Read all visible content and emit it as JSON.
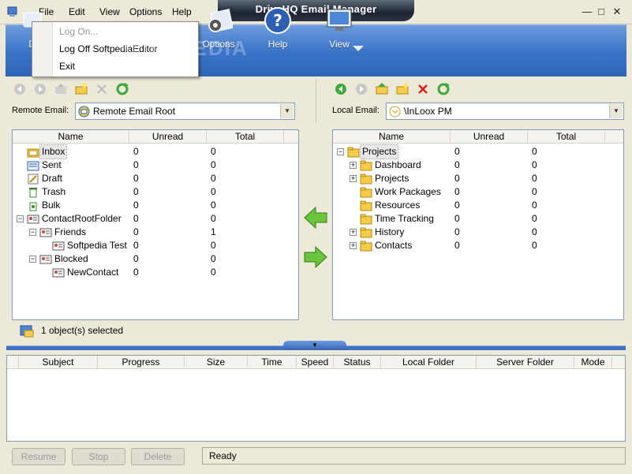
{
  "window": {
    "title": "DriveHQ Email Manager",
    "menu": [
      "File",
      "Edit",
      "View",
      "Options",
      "Help"
    ],
    "controls": {
      "minimize": "—",
      "restore": "□",
      "close": "✕"
    }
  },
  "ribbon": {
    "buttons": [
      {
        "label": "Di",
        "icon": "disconnect-icon"
      },
      {
        "label": "Options",
        "icon": "gear-icon"
      },
      {
        "label": "Help",
        "icon": "help-icon"
      },
      {
        "label": "View",
        "icon": "monitor-icon"
      }
    ]
  },
  "file_menu": {
    "items": [
      {
        "label": "Log On...",
        "disabled": true
      },
      {
        "label": "Log Off SoftpediaEditor",
        "disabled": false
      },
      {
        "label": "Exit",
        "disabled": false
      }
    ]
  },
  "remote": {
    "label": "Remote Email:",
    "selected": "Remote Email Root",
    "columns": [
      "Name",
      "Unread",
      "Total"
    ],
    "rows": [
      {
        "name": "Inbox",
        "unread": "0",
        "total": "0",
        "icon": "inbox-folder-icon",
        "level": 0,
        "expander": ""
      },
      {
        "name": "Sent",
        "unread": "0",
        "total": "0",
        "icon": "sent-folder-icon",
        "level": 0,
        "expander": ""
      },
      {
        "name": "Draft",
        "unread": "0",
        "total": "0",
        "icon": "draft-folder-icon",
        "level": 0,
        "expander": ""
      },
      {
        "name": "Trash",
        "unread": "0",
        "total": "0",
        "icon": "trash-icon",
        "level": 0,
        "expander": ""
      },
      {
        "name": "Bulk",
        "unread": "0",
        "total": "0",
        "icon": "bulk-folder-icon",
        "level": 0,
        "expander": ""
      },
      {
        "name": "ContactRootFolder",
        "unread": "0",
        "total": "0",
        "icon": "contact-card-icon",
        "level": 0,
        "expander": "−"
      },
      {
        "name": "Friends",
        "unread": "0",
        "total": "1",
        "icon": "contact-card-icon",
        "level": 1,
        "expander": "−"
      },
      {
        "name": "Softpedia Test",
        "unread": "0",
        "total": "0",
        "icon": "contact-card-icon",
        "level": 2,
        "expander": ""
      },
      {
        "name": "Blocked",
        "unread": "0",
        "total": "0",
        "icon": "contact-card-icon",
        "level": 1,
        "expander": "−"
      },
      {
        "name": "NewContact",
        "unread": "0",
        "total": "0",
        "icon": "contact-card-icon",
        "level": 2,
        "expander": ""
      }
    ]
  },
  "local": {
    "label": "Local Email:",
    "selected": "\\InLoox PM",
    "columns": [
      "Name",
      "Unread",
      "Total"
    ],
    "rows": [
      {
        "name": "Projects",
        "unread": "0",
        "total": "0",
        "icon": "folder-icon",
        "level": 0,
        "expander": "−"
      },
      {
        "name": "Dashboard",
        "unread": "0",
        "total": "0",
        "icon": "folder-icon",
        "level": 1,
        "expander": "+"
      },
      {
        "name": "Projects",
        "unread": "0",
        "total": "0",
        "icon": "folder-icon",
        "level": 1,
        "expander": "+"
      },
      {
        "name": "Work Packages",
        "unread": "0",
        "total": "0",
        "icon": "folder-icon",
        "level": 1,
        "expander": ""
      },
      {
        "name": "Resources",
        "unread": "0",
        "total": "0",
        "icon": "folder-icon",
        "level": 1,
        "expander": ""
      },
      {
        "name": "Time Tracking",
        "unread": "0",
        "total": "0",
        "icon": "folder-icon",
        "level": 1,
        "expander": ""
      },
      {
        "name": "History",
        "unread": "0",
        "total": "0",
        "icon": "folder-icon",
        "level": 1,
        "expander": "+"
      },
      {
        "name": "Contacts",
        "unread": "0",
        "total": "0",
        "icon": "folder-icon",
        "level": 1,
        "expander": "+"
      }
    ]
  },
  "status": {
    "selected_text": "1 object(s) selected",
    "ready_text": "Ready"
  },
  "transfer": {
    "columns": [
      "Subject",
      "Progress",
      "Size",
      "Time",
      "Speed",
      "Status",
      "Local Folder",
      "Server Folder",
      "Mode"
    ]
  },
  "buttons": {
    "resume": "Resume",
    "stop": "Stop",
    "delete": "Delete"
  },
  "watermark": "SOFTPEDIA",
  "colors": {
    "ribbon": "#3a73c6",
    "splitter": "#3f72c0",
    "folder": "#f5cc4a",
    "green_arrow": "#4cae2e"
  }
}
